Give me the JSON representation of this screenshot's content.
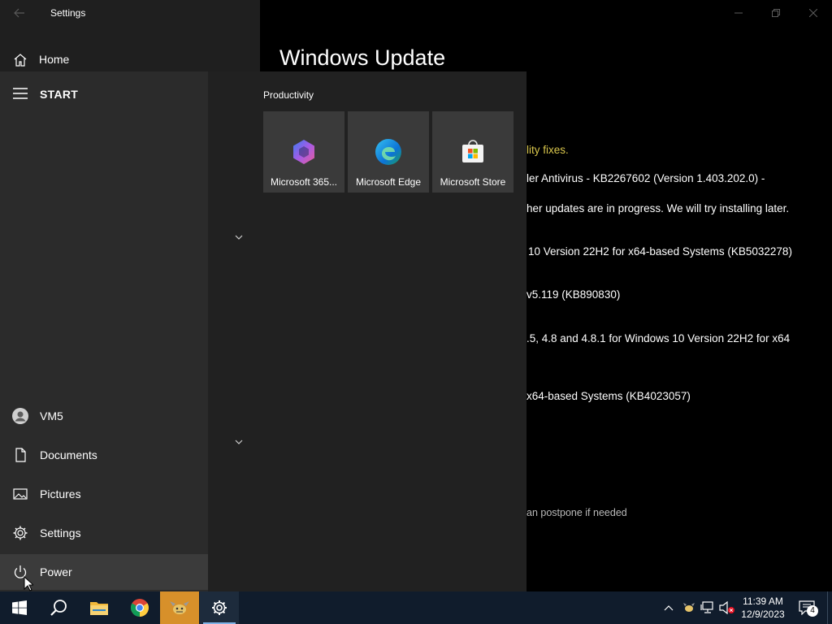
{
  "window": {
    "title": "Settings",
    "back_icon": "back-arrow-icon",
    "controls": [
      "minimize-icon",
      "restore-icon",
      "close-icon"
    ]
  },
  "settings_nav": {
    "home_label": "Home"
  },
  "main": {
    "page_title": "Windows Update",
    "lines": [
      "lity fixes.",
      "ler Antivirus - KB2267602 (Version 1.403.202.0) -",
      "her updates are in progress. We will try installing later.",
      "10 Version 22H2 for x64-based Systems (KB5032278)",
      "v5.119 (KB890830)",
      ".5, 4.8 and 4.8.1 for Windows 10 Version 22H2 for x64",
      " x64-based Systems (KB4023057)",
      "an postpone if needed"
    ]
  },
  "start_menu": {
    "header_label": "START",
    "rail_items": [
      {
        "label": "VM5",
        "icon": "user-avatar-icon"
      },
      {
        "label": "Documents",
        "icon": "document-icon"
      },
      {
        "label": "Pictures",
        "icon": "pictures-icon"
      },
      {
        "label": "Settings",
        "icon": "gear-icon"
      },
      {
        "label": "Power",
        "icon": "power-icon"
      }
    ],
    "group_title": "Productivity",
    "tiles": [
      {
        "label": "Microsoft 365...",
        "icon": "microsoft-365-icon"
      },
      {
        "label": "Microsoft Edge",
        "icon": "edge-icon"
      },
      {
        "label": "Microsoft Store",
        "icon": "store-icon"
      }
    ]
  },
  "taskbar": {
    "apps": [
      "windows-start-icon",
      "search-icon",
      "file-explorer-icon",
      "chrome-icon",
      "app-icon",
      "settings-gear-icon"
    ],
    "clock_time": "11:39 AM",
    "clock_date": "12/9/2023",
    "notification_count": "4"
  },
  "colors": {
    "yellow_text": "#d9c64c",
    "taskbar": "#101c2c",
    "highlight_app": "#d7902a"
  }
}
